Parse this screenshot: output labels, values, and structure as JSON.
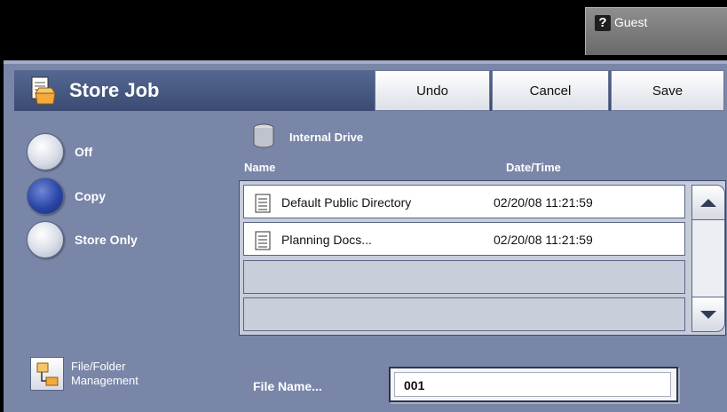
{
  "user": {
    "label": "Guest",
    "help_glyph": "?"
  },
  "header": {
    "title": "Store Job",
    "undo": "Undo",
    "cancel": "Cancel",
    "save": "Save"
  },
  "options": [
    {
      "label": "Off",
      "selected": false
    },
    {
      "label": "Copy",
      "selected": true
    },
    {
      "label": "Store Only",
      "selected": false
    }
  ],
  "file_folder": {
    "line1": "File/Folder",
    "line2": "Management"
  },
  "drive": {
    "label": "Internal Drive"
  },
  "columns": {
    "name": "Name",
    "date": "Date/Time"
  },
  "rows": [
    {
      "name": "Default Public Directory",
      "date": "02/20/08 11:21:59"
    },
    {
      "name": "Planning Docs...",
      "date": "02/20/08 11:21:59"
    }
  ],
  "file_name": {
    "label": "File Name...",
    "value": "001"
  },
  "colors": {
    "panel": "#7986a8",
    "header": "#3b4b73",
    "selected_radio": "#2a45a6"
  }
}
